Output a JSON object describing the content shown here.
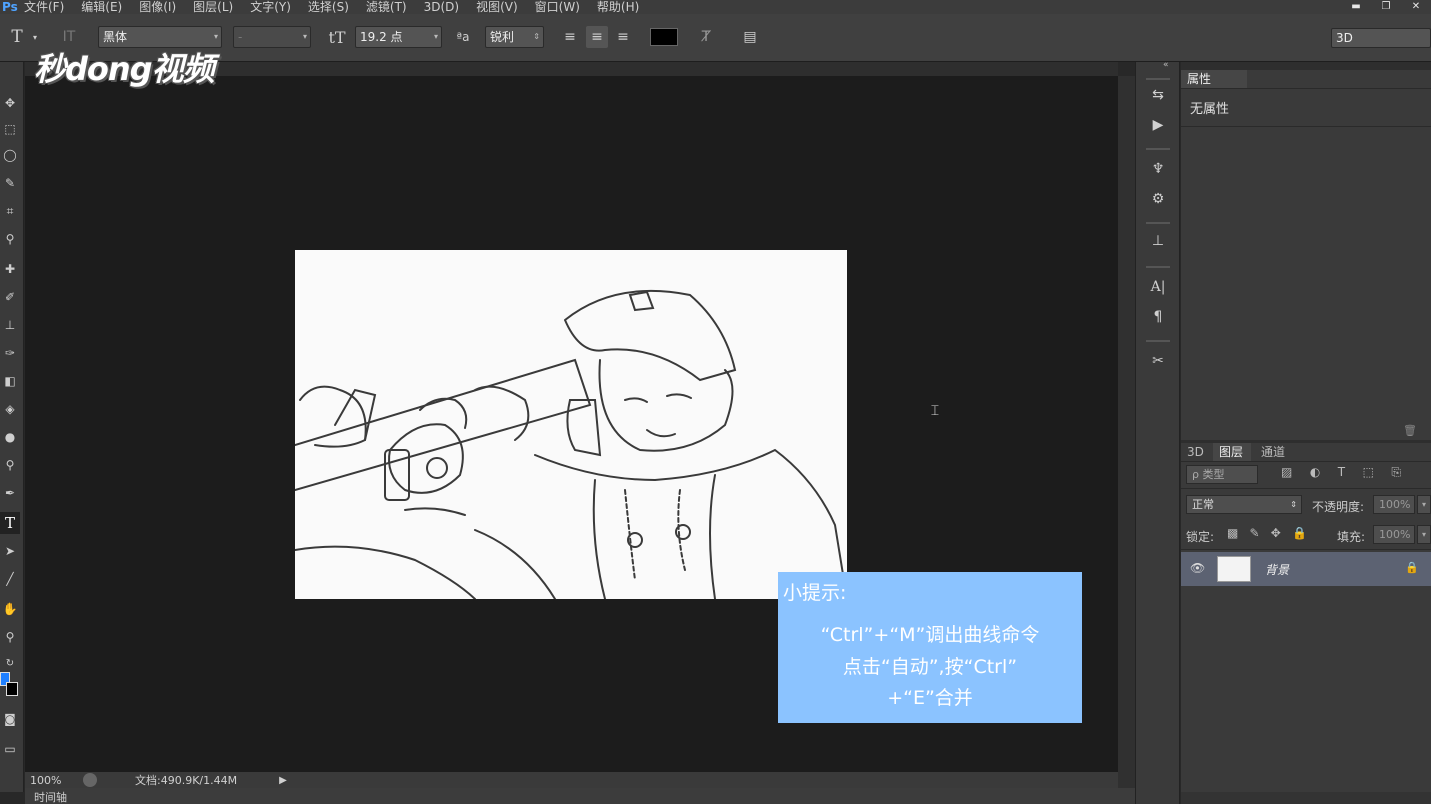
{
  "app": {
    "logo_text": "Ps"
  },
  "menu": [
    "文件(F)",
    "编辑(E)",
    "图像(I)",
    "图层(L)",
    "文字(Y)",
    "选择(S)",
    "滤镜(T)",
    "3D(D)",
    "视图(V)",
    "窗口(W)",
    "帮助(H)"
  ],
  "options": {
    "font_family": "黑体",
    "font_style": "-",
    "font_size": "19.2 点",
    "antialias": "锐利",
    "workspace": "3D"
  },
  "watermark": {
    "brand": "秒dong视频"
  },
  "tip": {
    "title": "小提示:",
    "line1": "“Ctrl”+“M”调出曲线命令",
    "line2": "点击“自动”,按“Ctrl”",
    "line3": "+“E”合并"
  },
  "status": {
    "zoom": "100%",
    "doc_info": "文档:490.9K/1.44M"
  },
  "timeline": {
    "label": "时间轴"
  },
  "properties": {
    "tab": "属性",
    "empty_text": "无属性"
  },
  "layers": {
    "tabs": [
      "3D",
      "图层",
      "通道"
    ],
    "filter": "ρ 类型",
    "blend_mode": "正常",
    "opacity_label": "不透明度:",
    "opacity_value": "100%",
    "lock_label": "锁定:",
    "fill_label": "填充:",
    "fill_value": "100%",
    "items": [
      {
        "name": "背景"
      }
    ]
  },
  "colors": {
    "tip_bg": "#8bc3ff",
    "foreground": "#1e7fff",
    "background": "#000000"
  }
}
